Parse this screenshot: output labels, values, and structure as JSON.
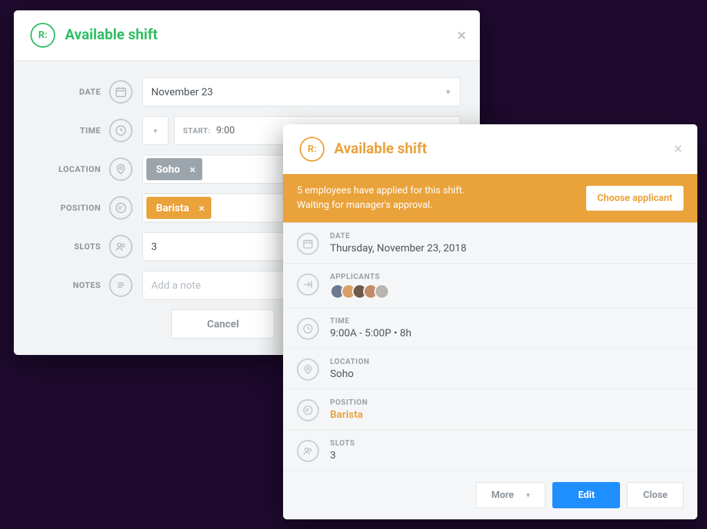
{
  "modal1": {
    "title": "Available shift",
    "logo_glyph": "R:",
    "fields": {
      "date": {
        "label": "DATE",
        "value": "November 23"
      },
      "time": {
        "label": "TIME",
        "start_label": "START:",
        "start_value": "9:00"
      },
      "location": {
        "label": "LOCATION",
        "chip": "Soho"
      },
      "position": {
        "label": "POSITION",
        "chip": "Barista"
      },
      "slots": {
        "label": "SLOTS",
        "value": "3"
      },
      "notes": {
        "label": "NOTES",
        "placeholder": "Add a note"
      }
    },
    "footer": {
      "cancel": "Cancel"
    },
    "colors": {
      "accent": "#2fbf63"
    }
  },
  "modal2": {
    "title": "Available shift",
    "logo_glyph": "R:",
    "banner": {
      "line1": "5 employees have applied for this shift.",
      "line2": "Waiting for manager's approval.",
      "button": "Choose applicant"
    },
    "details": {
      "date": {
        "label": "DATE",
        "value": "Thursday, November 23, 2018"
      },
      "applicants": {
        "label": "APPLICANTS",
        "count": 5
      },
      "time": {
        "label": "TIME",
        "value": "9:00A - 5:00P • 8h"
      },
      "location": {
        "label": "LOCATION",
        "value": "Soho"
      },
      "position": {
        "label": "POSITION",
        "value": "Barista"
      },
      "slots": {
        "label": "SLOTS",
        "value": "3"
      }
    },
    "footer": {
      "more": "More",
      "edit": "Edit",
      "close": "Close"
    },
    "colors": {
      "accent": "#eaa23b",
      "edit_button": "#1f8fff"
    }
  }
}
